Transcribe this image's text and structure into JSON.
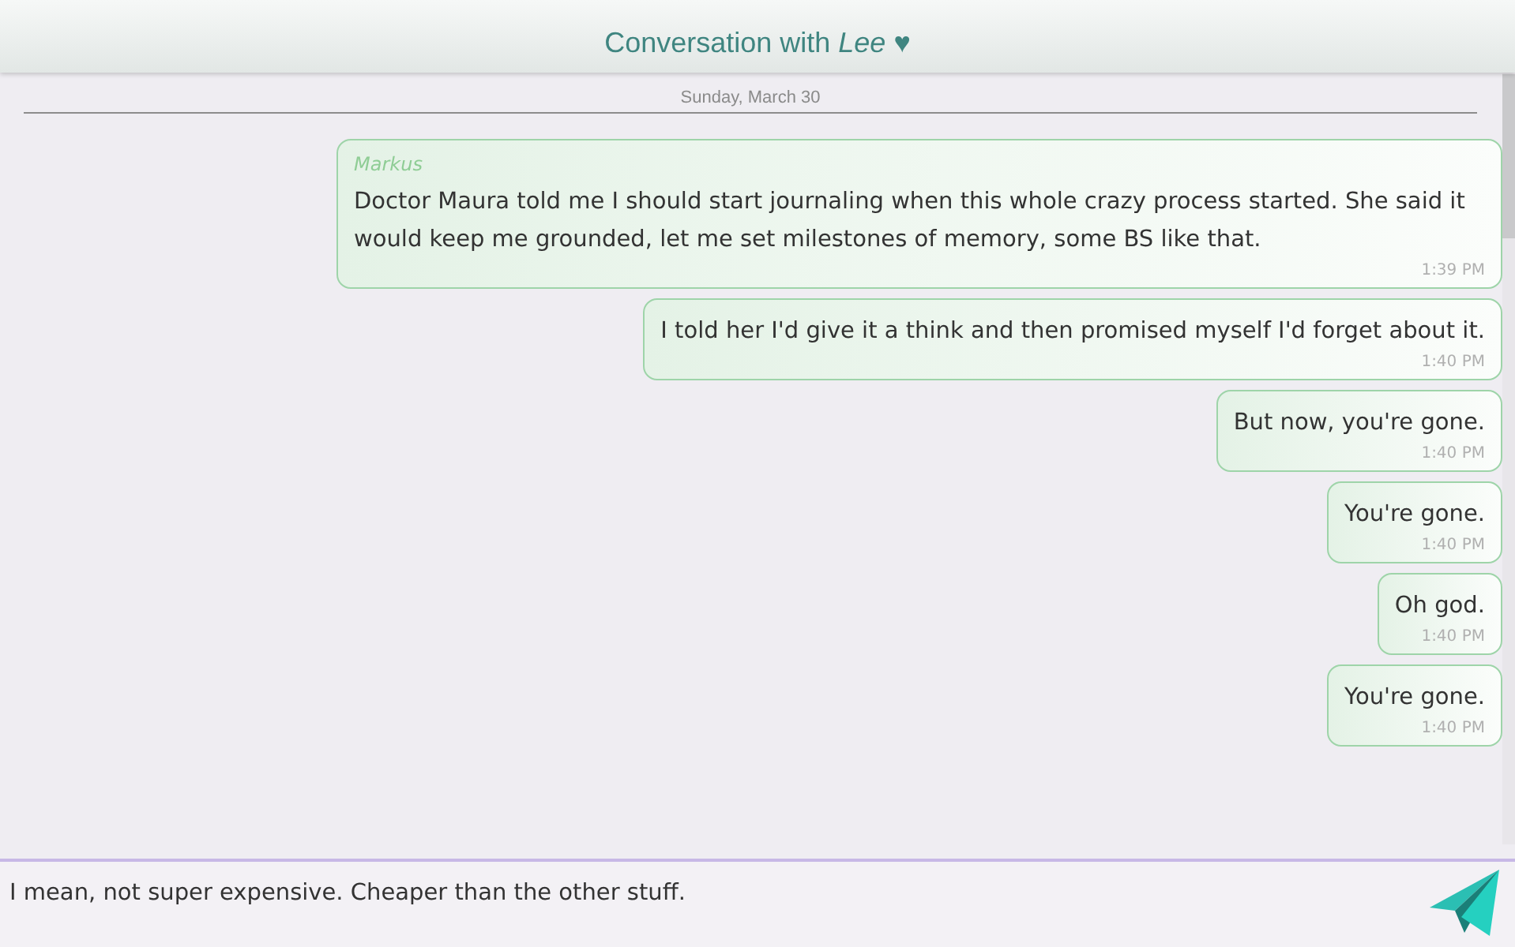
{
  "window": {
    "title": "Conversation with *Lee* ♥"
  },
  "date_divider": "Sunday, March 30",
  "messages": [
    {
      "sender": "Markus",
      "text": "Doctor Maura told me I should start journaling when this whole crazy process started. She said it would keep me grounded, let me set milestones of memory, some BS like that.",
      "time": "1:39 PM"
    },
    {
      "text": "I told her I'd give it a think and then promised myself I'd forget about it.",
      "time": "1:40 PM"
    },
    {
      "text": "But now, you're gone.",
      "time": "1:40 PM"
    },
    {
      "text": "You're gone.",
      "time": "1:40 PM"
    },
    {
      "text": "Oh god.",
      "time": "1:40 PM"
    },
    {
      "text": "You're gone.",
      "time": "1:40 PM"
    }
  ],
  "composer": {
    "value": "I mean, not super expensive. Cheaper than the other stuff."
  }
}
